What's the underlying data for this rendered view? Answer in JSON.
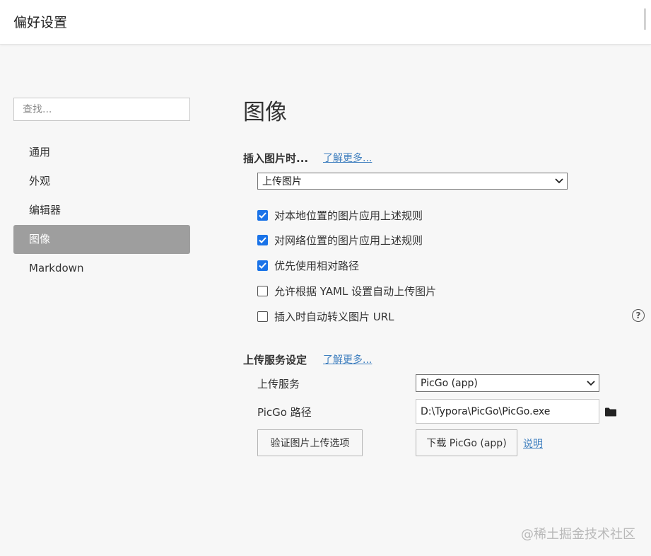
{
  "window": {
    "title": "偏好设置"
  },
  "sidebar": {
    "search_placeholder": "查找...",
    "items": [
      {
        "label": "通用",
        "active": false
      },
      {
        "label": "外观",
        "active": false
      },
      {
        "label": "编辑器",
        "active": false
      },
      {
        "label": "图像",
        "active": true
      },
      {
        "label": "Markdown",
        "active": false
      }
    ]
  },
  "main": {
    "title": "图像",
    "insert_section": {
      "title": "插入图片时...",
      "learn_more": "了解更多...",
      "select_value": "上传图片",
      "checkboxes": [
        {
          "label": "对本地位置的图片应用上述规则",
          "checked": true
        },
        {
          "label": "对网络位置的图片应用上述规则",
          "checked": true
        },
        {
          "label": "优先使用相对路径",
          "checked": true
        },
        {
          "label": "允许根据 YAML 设置自动上传图片",
          "checked": false
        },
        {
          "label": "插入时自动转义图片 URL",
          "checked": false
        }
      ]
    },
    "upload_section": {
      "title": "上传服务设定",
      "learn_more": "了解更多...",
      "service_label": "上传服务",
      "service_value": "PicGo (app)",
      "path_label": "PicGo 路径",
      "path_value": "D:\\Typora\\PicGo\\PicGo.exe",
      "verify_button": "验证图片上传选项",
      "download_button": "下载 PicGo (app)",
      "explain_link": "说明"
    }
  },
  "watermark": "@稀土掘金技术社区",
  "colors": {
    "accent": "#1a73e8",
    "active_nav": "#9e9e9e",
    "link": "#3f7fbf"
  }
}
